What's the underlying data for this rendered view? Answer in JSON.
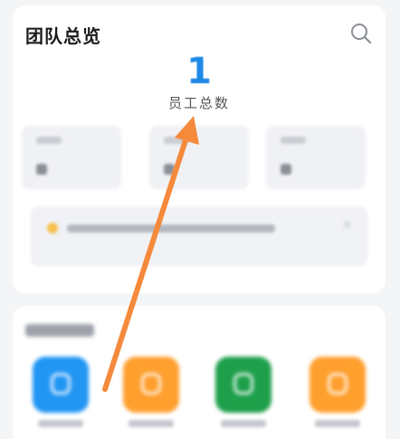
{
  "overview": {
    "title": "团队总览",
    "employee_count": "1",
    "employee_count_label": "员工总数",
    "icons": {
      "search": "search-icon"
    }
  },
  "stats": [
    {
      "label": "",
      "value": ""
    },
    {
      "label": "",
      "value": ""
    },
    {
      "label": "",
      "value": ""
    }
  ],
  "notice": {
    "icon": "warning-icon",
    "text": ""
  },
  "management": {
    "title": "",
    "apps": [
      {
        "label": "",
        "color": "#2196f3",
        "icon": "person-icon"
      },
      {
        "label": "",
        "color": "#ff9f2e",
        "icon": "person-icon"
      },
      {
        "label": "",
        "color": "#1ea04b",
        "icon": "briefcase-icon"
      },
      {
        "label": "",
        "color": "#ff9f2e",
        "icon": "app-icon"
      }
    ]
  },
  "annotation": {
    "arrow_color": "#f58a3c"
  }
}
